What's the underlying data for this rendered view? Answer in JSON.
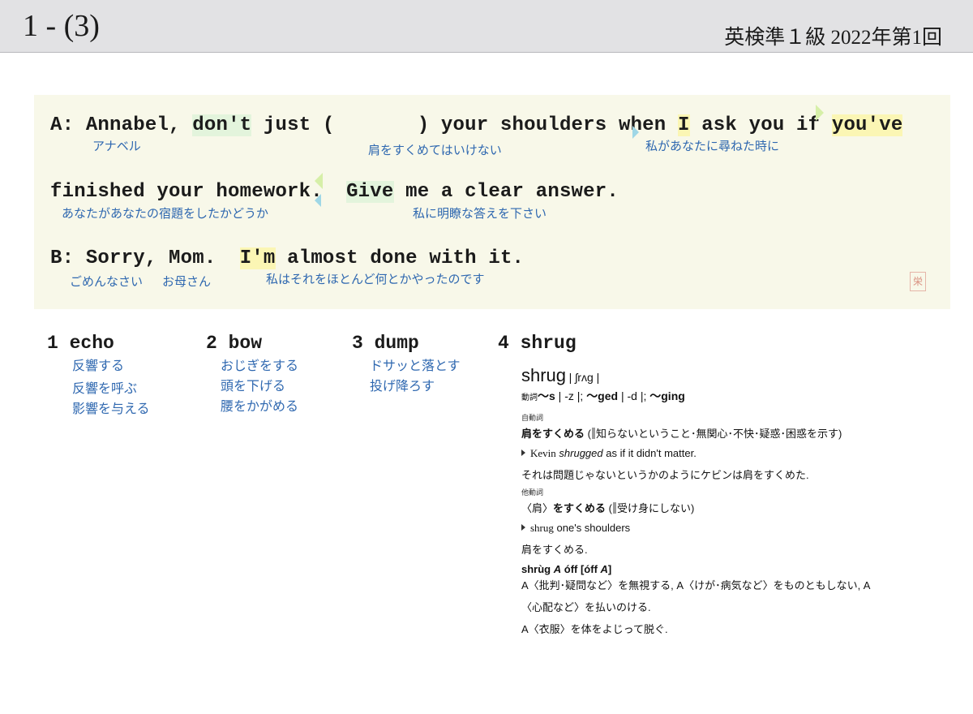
{
  "header": {
    "title": "1 - (3)",
    "source": "英検準１級  2022年第1回"
  },
  "dialogue": {
    "line1": {
      "speaker": "A:",
      "text_a": "Annabel,",
      "text_b": "don't",
      "text_c": "just (       ) your shoulders when",
      "text_d": "I",
      "text_e": "ask you if",
      "text_f": "you've"
    },
    "line2": {
      "text_a": "finished your homework.",
      "text_b": "Give",
      "text_c": "me a clear answer."
    },
    "line3": {
      "speaker": "B:",
      "text_a": "Sorry, Mom.",
      "text_b": "I'm",
      "text_c": "almost done with it."
    },
    "glosses": {
      "annabel": "アナベル",
      "dont_shrug": "肩をすくめてはいけない",
      "when_i_ask": "私があなたに尋ねた時に",
      "finished_homework": "あなたがあなたの宿題をしたかどうか",
      "give_answer": "私に明瞭な答えを下さい",
      "sorry": "ごめんなさい",
      "mom": "お母さん",
      "almost_done": "私はそれをほとんど何とかやったのです"
    }
  },
  "choices": [
    {
      "num": "1",
      "word": "echo",
      "meanings": [
        "反響する",
        "反響を呼ぶ",
        "影響を与える"
      ]
    },
    {
      "num": "2",
      "word": "bow",
      "meanings": [
        "おじぎをする",
        "頭を下げる",
        "腰をかがめる"
      ]
    },
    {
      "num": "3",
      "word": "dump",
      "meanings": [
        "ドサッと落とす",
        "投げ降ろす"
      ]
    },
    {
      "num": "4",
      "word": "shrug",
      "meanings": []
    }
  ],
  "dictionary": {
    "headword": "shrug",
    "pronunciation": "| ʃrʌg |",
    "pos_verb": "動詞",
    "inflection_1": "〜s",
    "inflection_1b": " | -z |; ",
    "inflection_2": "〜ged",
    "inflection_2b": " | -d |; ",
    "inflection_3": "〜ging",
    "intransitive_label": "自動詞",
    "intransitive_sense": "肩をすくめる",
    "intransitive_note_open": " (",
    "intransitive_note": "知らないということ･無関心･不快･疑惑･困惑を示す)",
    "example1_a": "Kevin",
    "example1_b": "shrugged",
    "example1_c": "as if it didn't matter.",
    "example1_ja": "それは問題じゃないというかのようにケビンは肩をすくめた.",
    "transitive_label": "他動詞",
    "transitive_sense_a": "〈肩〉",
    "transitive_sense_b": "をすくめる",
    "transitive_note_open": " (",
    "transitive_note": "受け身にしない)",
    "example2_a": "shrug",
    "example2_b": "one's shoulders",
    "example2_ja": "肩をすくめる.",
    "phrasal_a": "shrùg",
    "phrasal_b": "A",
    "phrasal_c": "óff [óff",
    "phrasal_d": "A",
    "phrasal_e": "]",
    "phrasal_def1": "A〈批判･疑問など〉を無視する, A〈けが･病気など〉をものともしない, A",
    "phrasal_def2": "〈心配など〉を払いのける.",
    "phrasal_def3": "A〈衣服〉を体をよじって脱ぐ."
  },
  "stamp": "栄"
}
